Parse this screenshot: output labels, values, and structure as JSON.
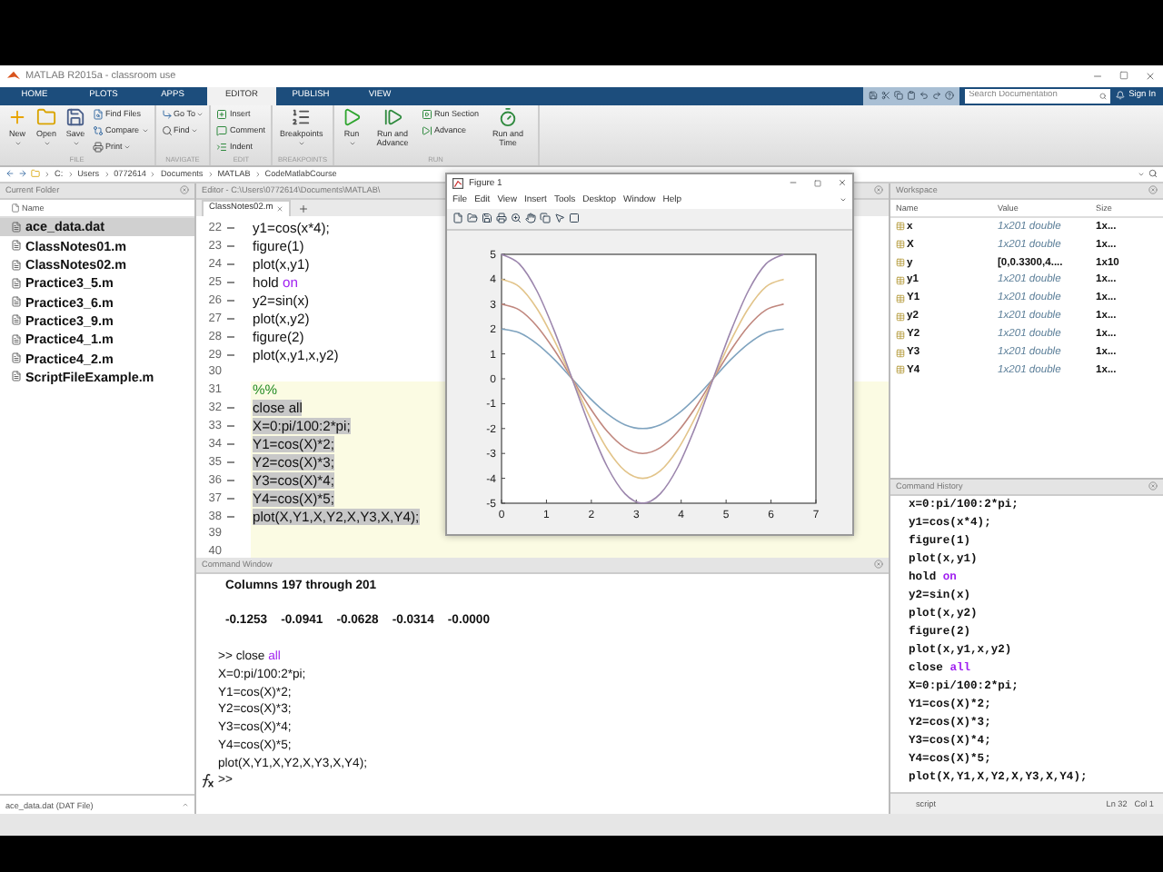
{
  "window": {
    "title": "MATLAB R2015a - classroom use"
  },
  "tabs": [
    {
      "label": "HOME",
      "selected": false
    },
    {
      "label": "PLOTS",
      "selected": false
    },
    {
      "label": "APPS",
      "selected": false
    },
    {
      "label": "EDITOR",
      "selected": true
    },
    {
      "label": "PUBLISH",
      "selected": false
    },
    {
      "label": "VIEW",
      "selected": false
    }
  ],
  "search": {
    "placeholder": "Search Documentation"
  },
  "sign_in": "Sign In",
  "ribbon": [
    {
      "label": "FILE",
      "buttons": [
        {
          "label": "New",
          "kind": "large",
          "dropdown": true
        },
        {
          "label": "Open",
          "kind": "large",
          "dropdown": true
        },
        {
          "label": "Save",
          "kind": "large",
          "dropdown": true
        },
        {
          "label": "Find Files",
          "kind": "small",
          "dropdown": false
        },
        {
          "label": "Compare",
          "kind": "small",
          "dropdown": true
        },
        {
          "label": "Print",
          "kind": "small",
          "dropdown": true
        }
      ]
    },
    {
      "label": "NAVIGATE",
      "buttons": [
        {
          "label": "Go To",
          "kind": "small",
          "dropdown": true
        },
        {
          "label": "Find",
          "kind": "small",
          "dropdown": true
        }
      ]
    },
    {
      "label": "EDIT",
      "buttons": [
        {
          "label": "Insert",
          "kind": "small",
          "dropdown": false
        },
        {
          "label": "Comment",
          "kind": "small",
          "dropdown": false
        },
        {
          "label": "Indent",
          "kind": "small",
          "dropdown": false
        }
      ]
    },
    {
      "label": "BREAKPOINTS",
      "buttons": [
        {
          "label": "Breakpoints",
          "kind": "large",
          "dropdown": true
        }
      ]
    },
    {
      "label": "RUN",
      "buttons": [
        {
          "label": "Run",
          "kind": "large",
          "dropdown": true
        },
        {
          "label": "Run and Advance",
          "kind": "large",
          "dropdown": false
        },
        {
          "label": "Run Section",
          "kind": "small",
          "dropdown": false
        },
        {
          "label": "Advance",
          "kind": "small",
          "dropdown": false
        },
        {
          "label": "Run and Time",
          "kind": "large",
          "dropdown": false
        }
      ]
    }
  ],
  "address": [
    "C:",
    "Users",
    "0772614",
    "Documents",
    "MATLAB",
    "CodeMatlabCourse"
  ],
  "current_folder": {
    "title": "Current Folder",
    "column": "Name",
    "details": "ace_data.dat  (DAT File)",
    "files": [
      {
        "name": "ace_data.dat",
        "selected": true
      },
      {
        "name": "ClassNotes01.m",
        "selected": false
      },
      {
        "name": "ClassNotes02.m",
        "selected": false
      },
      {
        "name": "Practice3_5.m",
        "selected": false
      },
      {
        "name": "Practice3_6.m",
        "selected": false
      },
      {
        "name": "Practice3_9.m",
        "selected": false
      },
      {
        "name": "Practice4_1.m",
        "selected": false
      },
      {
        "name": "Practice4_2.m",
        "selected": false
      },
      {
        "name": "ScriptFileExample.m",
        "selected": false
      }
    ]
  },
  "editor": {
    "title": "Editor - C:\\Users\\0772614\\Documents\\MATLAB\\",
    "tabs": [
      {
        "label": "ClassNotes02.m",
        "selected": true
      }
    ],
    "lines": [
      {
        "number": "22",
        "executable": true,
        "cell": false,
        "selected": false,
        "code": [
          {
            "text": "y1=cos(x*4);",
            "kind": "plain"
          }
        ]
      },
      {
        "number": "23",
        "executable": true,
        "cell": false,
        "selected": false,
        "code": [
          {
            "text": "figure(1)",
            "kind": "plain"
          }
        ]
      },
      {
        "number": "24",
        "executable": true,
        "cell": false,
        "selected": false,
        "code": [
          {
            "text": "plot(x,y1)",
            "kind": "plain"
          }
        ]
      },
      {
        "number": "25",
        "executable": true,
        "cell": false,
        "selected": false,
        "code": [
          {
            "text": "hold ",
            "kind": "plain"
          },
          {
            "text": "on",
            "kind": "keyword"
          }
        ]
      },
      {
        "number": "26",
        "executable": true,
        "cell": false,
        "selected": false,
        "code": [
          {
            "text": "y2=sin(x)",
            "kind": "plain"
          }
        ]
      },
      {
        "number": "27",
        "executable": true,
        "cell": false,
        "selected": false,
        "code": [
          {
            "text": "plot(x,y2)",
            "kind": "plain"
          }
        ]
      },
      {
        "number": "28",
        "executable": true,
        "cell": false,
        "selected": false,
        "code": [
          {
            "text": "figure(2)",
            "kind": "plain"
          }
        ]
      },
      {
        "number": "29",
        "executable": true,
        "cell": false,
        "selected": false,
        "code": [
          {
            "text": "plot(x,y1,x,y2)",
            "kind": "plain"
          }
        ]
      },
      {
        "number": "30",
        "executable": false,
        "cell": false,
        "selected": false
      },
      {
        "number": "31",
        "executable": false,
        "cell": true,
        "selected": false,
        "code": [
          {
            "text": "%%",
            "kind": "comment"
          }
        ]
      },
      {
        "number": "32",
        "executable": true,
        "cell": true,
        "selected": true,
        "code": [
          {
            "text": "close all",
            "kind": "plain"
          }
        ]
      },
      {
        "number": "33",
        "executable": true,
        "cell": true,
        "selected": true,
        "code": [
          {
            "text": "X=0:pi/100:2*pi;",
            "kind": "plain"
          }
        ]
      },
      {
        "number": "34",
        "executable": true,
        "cell": true,
        "selected": true,
        "code": [
          {
            "text": "Y1=cos(X)*2;",
            "kind": "plain"
          }
        ]
      },
      {
        "number": "35",
        "executable": true,
        "cell": true,
        "selected": true,
        "code": [
          {
            "text": "Y2=cos(X)*3;",
            "kind": "plain"
          }
        ]
      },
      {
        "number": "36",
        "executable": true,
        "cell": true,
        "selected": true,
        "code": [
          {
            "text": "Y3=cos(X)*4;",
            "kind": "plain"
          }
        ]
      },
      {
        "number": "37",
        "executable": true,
        "cell": true,
        "selected": true,
        "code": [
          {
            "text": "Y4=cos(X)*5;",
            "kind": "plain"
          }
        ]
      },
      {
        "number": "38",
        "executable": true,
        "cell": true,
        "selected": true,
        "code": [
          {
            "text": "plot(X,Y1,X,Y2,X,Y3,X,Y4);",
            "kind": "plain"
          }
        ]
      },
      {
        "number": "39",
        "executable": false,
        "cell": true,
        "selected": false
      },
      {
        "number": "40",
        "executable": false,
        "cell": true,
        "selected": false
      }
    ]
  },
  "figure": {
    "title": "Figure 1",
    "menu": [
      "File",
      "Edit",
      "View",
      "Insert",
      "Tools",
      "Desktop",
      "Window",
      "Help"
    ],
    "chart_data": {
      "type": "line",
      "x": [
        0,
        0.393,
        0.785,
        1.178,
        1.571,
        1.963,
        2.356,
        2.749,
        3.142,
        3.534,
        3.927,
        4.32,
        4.712,
        5.105,
        5.498,
        5.89,
        6.283
      ],
      "xlim": [
        0,
        7
      ],
      "ylim": [
        -5,
        5
      ],
      "xticks": [
        0,
        1,
        2,
        3,
        4,
        5,
        6,
        7
      ],
      "yticks": [
        -5,
        -4,
        -3,
        -2,
        -1,
        0,
        1,
        2,
        3,
        4,
        5
      ],
      "series": [
        {
          "color": "#7fa3bf",
          "values": [
            2,
            1.85,
            1.41,
            0.77,
            0,
            -0.77,
            -1.41,
            -1.85,
            -2,
            -1.85,
            -1.41,
            -0.77,
            0,
            0.77,
            1.41,
            1.85,
            2
          ]
        },
        {
          "color": "#c0877e",
          "values": [
            3,
            2.77,
            2.12,
            1.15,
            0,
            -1.15,
            -2.12,
            -2.77,
            -3,
            -2.77,
            -2.12,
            -1.15,
            0,
            1.15,
            2.12,
            2.77,
            3
          ]
        },
        {
          "color": "#e2c48a",
          "values": [
            4,
            3.7,
            2.83,
            1.53,
            0,
            -1.53,
            -2.83,
            -3.7,
            -4,
            -3.7,
            -2.83,
            -1.53,
            0,
            1.53,
            2.83,
            3.7,
            4
          ]
        },
        {
          "color": "#9c86ad",
          "values": [
            5,
            4.62,
            3.54,
            1.91,
            0,
            -1.91,
            -3.54,
            -4.62,
            -5,
            -4.62,
            -3.54,
            -1.91,
            0,
            1.91,
            3.54,
            4.62,
            5
          ]
        }
      ]
    }
  },
  "command_window": {
    "title": "Command Window",
    "prompt": ">>",
    "lines": [
      {
        "kind": "output",
        "code": [
          {
            "text": "Columns 197 through 201",
            "kind": "plain"
          }
        ]
      },
      {
        "kind": "blank"
      },
      {
        "kind": "output",
        "code": [
          {
            "text": "-0.1253    -0.0941    -0.0628    -0.0314    -0.0000",
            "kind": "plain"
          }
        ]
      },
      {
        "kind": "blank"
      },
      {
        "kind": "input",
        "code": [
          {
            "text": ">> close ",
            "kind": "plain"
          },
          {
            "text": "all",
            "kind": "keyword"
          }
        ]
      },
      {
        "kind": "input",
        "code": [
          {
            "text": "X=0:pi/100:2*pi;",
            "kind": "plain"
          }
        ]
      },
      {
        "kind": "input",
        "code": [
          {
            "text": "Y1=cos(X)*2;",
            "kind": "plain"
          }
        ]
      },
      {
        "kind": "input",
        "code": [
          {
            "text": "Y2=cos(X)*3;",
            "kind": "plain"
          }
        ]
      },
      {
        "kind": "input",
        "code": [
          {
            "text": "Y3=cos(X)*4;",
            "kind": "plain"
          }
        ]
      },
      {
        "kind": "input",
        "code": [
          {
            "text": "Y4=cos(X)*5;",
            "kind": "plain"
          }
        ]
      },
      {
        "kind": "input",
        "code": [
          {
            "text": "plot(X,Y1,X,Y2,X,Y3,X,Y4);",
            "kind": "plain"
          }
        ]
      }
    ]
  },
  "workspace": {
    "title": "Workspace",
    "columns": [
      "Name",
      "Value",
      "Size"
    ],
    "rows": [
      {
        "name": "x",
        "value": "1x201 double",
        "size": "1x...",
        "kind": "summary"
      },
      {
        "name": "X",
        "value": "1x201 double",
        "size": "1x...",
        "kind": "summary"
      },
      {
        "name": "y",
        "value": "[0,0.3300,4....",
        "size": "1x10",
        "kind": "literal"
      },
      {
        "name": "y1",
        "value": "1x201 double",
        "size": "1x...",
        "kind": "summary"
      },
      {
        "name": "Y1",
        "value": "1x201 double",
        "size": "1x...",
        "kind": "summary"
      },
      {
        "name": "y2",
        "value": "1x201 double",
        "size": "1x...",
        "kind": "summary"
      },
      {
        "name": "Y2",
        "value": "1x201 double",
        "size": "1x...",
        "kind": "summary"
      },
      {
        "name": "Y3",
        "value": "1x201 double",
        "size": "1x...",
        "kind": "summary"
      },
      {
        "name": "Y4",
        "value": "1x201 double",
        "size": "1x...",
        "kind": "summary"
      }
    ]
  },
  "command_history": {
    "title": "Command History",
    "entries": [
      [
        {
          "text": "x=0:pi/100:2*pi;",
          "kind": "plain"
        }
      ],
      [
        {
          "text": "y1=cos(x*4);",
          "kind": "plain"
        }
      ],
      [
        {
          "text": "figure(1)",
          "kind": "plain"
        }
      ],
      [
        {
          "text": "plot(x,y1)",
          "kind": "plain"
        }
      ],
      [
        {
          "text": "hold ",
          "kind": "plain"
        },
        {
          "text": "on",
          "kind": "keyword"
        }
      ],
      [
        {
          "text": "y2=sin(x)",
          "kind": "plain"
        }
      ],
      [
        {
          "text": "plot(x,y2)",
          "kind": "plain"
        }
      ],
      [
        {
          "text": "figure(2)",
          "kind": "plain"
        }
      ],
      [
        {
          "text": "plot(x,y1,x,y2)",
          "kind": "plain"
        }
      ],
      [
        {
          "text": "close ",
          "kind": "plain"
        },
        {
          "text": "all",
          "kind": "keyword"
        }
      ],
      [
        {
          "text": "X=0:pi/100:2*pi;",
          "kind": "plain"
        }
      ],
      [
        {
          "text": "Y1=cos(X)*2;",
          "kind": "plain"
        }
      ],
      [
        {
          "text": "Y2=cos(X)*3;",
          "kind": "plain"
        }
      ],
      [
        {
          "text": "Y3=cos(X)*4;",
          "kind": "plain"
        }
      ],
      [
        {
          "text": "Y4=cos(X)*5;",
          "kind": "plain"
        }
      ],
      [
        {
          "text": "plot(X,Y1,X,Y2,X,Y3,X,Y4);",
          "kind": "plain"
        }
      ]
    ]
  },
  "status_bar": {
    "file_type": "script",
    "line": "Ln 32",
    "column": "Col 1"
  }
}
